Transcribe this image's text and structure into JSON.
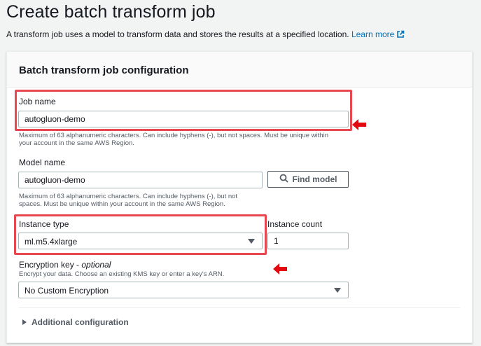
{
  "page": {
    "title": "Create batch transform job",
    "description": "A transform job uses a model to transform data and stores the results at a specified location.",
    "learn_more": "Learn more",
    "external_icon": "external-link-icon"
  },
  "panel": {
    "title": "Batch transform job configuration"
  },
  "job_name": {
    "label": "Job name",
    "value": "autogluon-demo",
    "hint_line1": "Maximum of 63 alphanumeric characters. Can include hyphens (-), but not spaces. Must be unique within",
    "hint_line2": "your account in the same AWS Region."
  },
  "model_name": {
    "label": "Model name",
    "value": "autogluon-demo",
    "hint_line1": "Maximum of 63 alphanumeric characters. Can include hyphens (-), but not",
    "hint_line2": "spaces. Must be unique within your account in the same AWS Region.",
    "find_button": "Find model",
    "find_icon": "search-icon"
  },
  "instance_type": {
    "label": "Instance type",
    "value": "ml.m5.4xlarge"
  },
  "instance_count": {
    "label": "Instance count",
    "value": "1"
  },
  "encryption": {
    "label": "Encryption key - ",
    "label_optional": "optional",
    "hint": "Encrypt your data. Choose an existing KMS key or enter a key's ARN.",
    "value": "No Custom Encryption"
  },
  "additional": {
    "label": "Additional configuration"
  },
  "colors": {
    "highlight": "#e8474f",
    "arrow": "#e3070f",
    "link": "#0073bb"
  }
}
